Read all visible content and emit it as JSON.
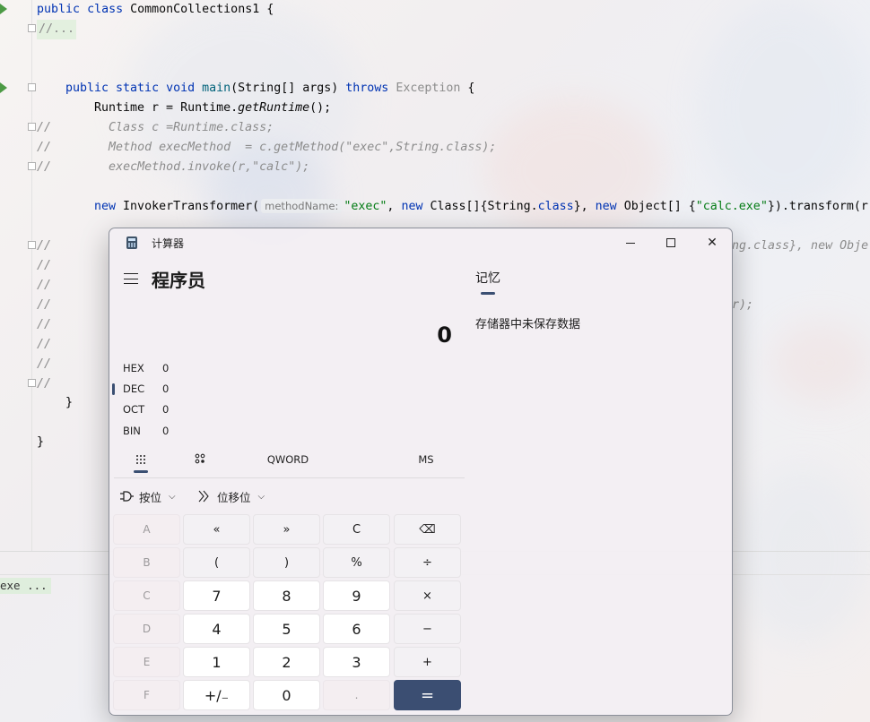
{
  "editor": {
    "code_lines": {
      "l1_public": "public",
      "l1_class": "class",
      "l1_name": "CommonCollections1 {",
      "l2_fold": "//...",
      "l3_mods": "public static void",
      "l3_main": "main",
      "l3_args": "(String[] args)",
      "l3_throws": "throws",
      "l3_exception": "Exception",
      "l3_brace": "{",
      "l4_pre": "Runtime r = Runtime.",
      "l4_call": "getRuntime",
      "l4_end": "();",
      "l5": "//        Class c =Runtime.class;",
      "l6": "//        Method execMethod  = c.getMethod(\"exec\",String.class);",
      "l7": "//        execMethod.invoke(r,\"calc\");",
      "l8_new": "new",
      "l8_type": "InvokerTransformer(",
      "l8_hint": "methodName:",
      "l8_exec": "\"exec\"",
      "l8_comma": ",",
      "l8_new2": "new",
      "l8_class1": "Class[]{String.",
      "l8_classkw": "class",
      "l8_mid": "},",
      "l8_new3": "new",
      "l8_obj": "Object[] {",
      "l8_calc": "\"calc.exe\"",
      "l8_end": "}).transform(r",
      "l9_tail": "ng.class}, new Obje",
      "l12_tail": "r);",
      "close_inner": "}",
      "close_outer": "}"
    },
    "comment_marker": "//",
    "console_text": "exe ..."
  },
  "calculator": {
    "window_title": "计算器",
    "title_buttons": {
      "minimize": "—",
      "maximize": "□",
      "close": "✕"
    },
    "mode": "程序员",
    "display_value": "0",
    "radix": [
      {
        "label": "HEX",
        "value": "0"
      },
      {
        "label": "DEC",
        "value": "0"
      },
      {
        "label": "OCT",
        "value": "0"
      },
      {
        "label": "BIN",
        "value": "0"
      }
    ],
    "selected_radix": "DEC",
    "tabs": {
      "word_size": "QWORD",
      "memory_store": "MS"
    },
    "bitwise_label": "按位",
    "bitshift_label": "位移位",
    "keys": [
      [
        "A",
        "«",
        "»",
        "C",
        "⌫"
      ],
      [
        "B",
        "(",
        ")",
        "%",
        "÷"
      ],
      [
        "C",
        "7",
        "8",
        "9",
        "×"
      ],
      [
        "D",
        "4",
        "5",
        "6",
        "−"
      ],
      [
        "E",
        "1",
        "2",
        "3",
        "+"
      ],
      [
        "F",
        "+/₋",
        "0",
        ".",
        "="
      ]
    ],
    "memory_title": "记忆",
    "memory_empty": "存储器中未保存数据"
  },
  "colors": {
    "keyword": "#0033b3",
    "method": "#00627a",
    "string": "#067d17",
    "comment": "#8c8c8c",
    "accent": "#3b4e72"
  }
}
